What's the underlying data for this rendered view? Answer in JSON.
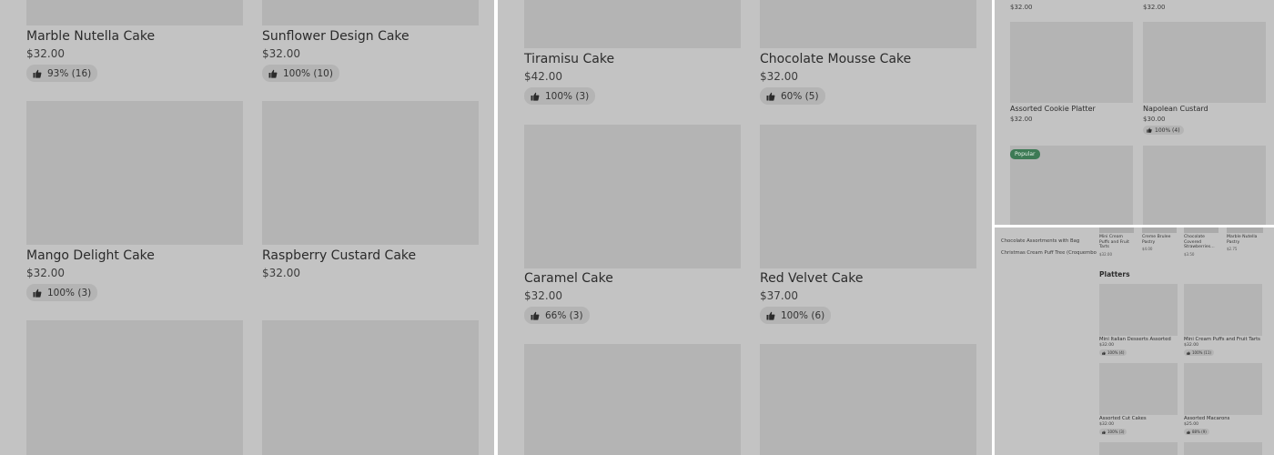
{
  "panel_a": {
    "items": [
      {
        "name": "Marble Nutella Cake",
        "price": "$32.00",
        "rating": "93% (16)"
      },
      {
        "name": "Sunflower Design Cake",
        "price": "$32.00",
        "rating": "100% (10)"
      },
      {
        "name": "Mango Delight Cake",
        "price": "$32.00",
        "rating": "100% (3)"
      },
      {
        "name": "Raspberry Custard Cake",
        "price": "$32.00",
        "rating": ""
      }
    ]
  },
  "panel_b": {
    "items": [
      {
        "name": "Tiramisu Cake",
        "price": "$42.00",
        "rating": "100% (3)"
      },
      {
        "name": "Chocolate Mousse Cake",
        "price": "$32.00",
        "rating": "60% (5)"
      },
      {
        "name": "Caramel Cake",
        "price": "$32.00",
        "rating": "66% (3)"
      },
      {
        "name": "Red Velvet Cake",
        "price": "$37.00",
        "rating": "100% (6)"
      }
    ]
  },
  "panel_c": {
    "top_prices": [
      "$32.00",
      "$32.00"
    ],
    "items": [
      {
        "name": "Assorted Cookie Platter",
        "price": "$32.00",
        "rating": ""
      },
      {
        "name": "Napolean Custard",
        "price": "$30.00",
        "rating": "100% (4)"
      }
    ],
    "badge": "Popular"
  },
  "panel_d": {
    "sidebar_links": [
      "Chocolate Assortments with Bag",
      "Christmas Cream Puff Tree (Croquembo"
    ],
    "strip_items": [
      {
        "name": "Mini Cream Puffs and Fruit Tarts",
        "price": "$32.00"
      },
      {
        "name": "Creme Brulee Pastry",
        "price": "$4.00"
      },
      {
        "name": "Chocolate Covered Strawberries…",
        "price": "$3.50"
      },
      {
        "name": "Marble Nutella Pastry",
        "price": "$2.75"
      }
    ],
    "section_title": "Platters",
    "items": [
      {
        "name": "Mini Italian Desserts Assorted",
        "price": "$32.00",
        "rating": "100% (4)"
      },
      {
        "name": "Mini Cream Puffs and Fruit Tarts",
        "price": "$32.00",
        "rating": "100% (11)"
      },
      {
        "name": "Assorted Cut Cakes",
        "price": "$32.00",
        "rating": "100% (3)"
      },
      {
        "name": "Assorted Macarons",
        "price": "$25.00",
        "rating": "88% (9)"
      }
    ]
  }
}
